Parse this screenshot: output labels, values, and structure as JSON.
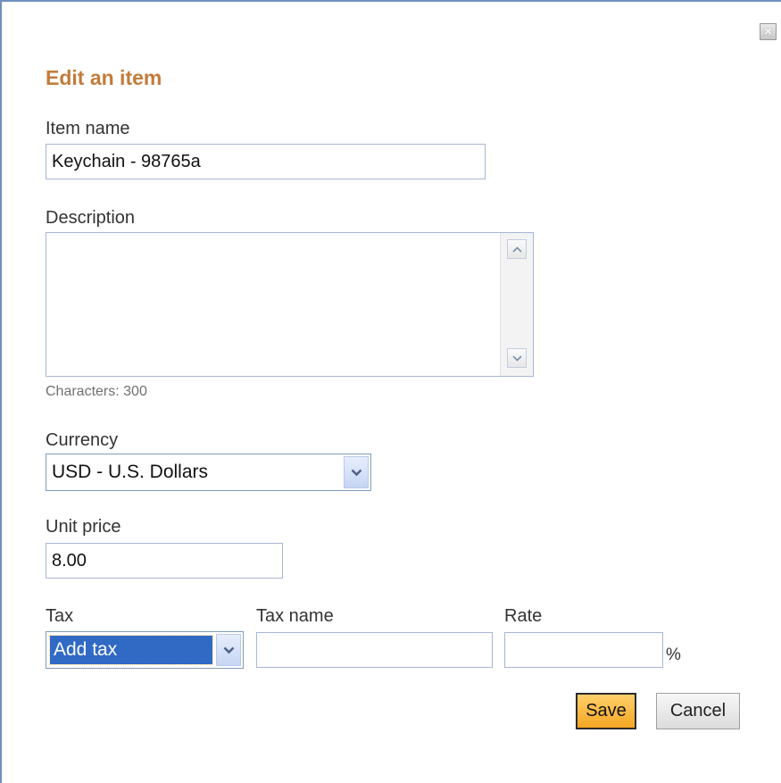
{
  "dialog": {
    "title": "Edit an item",
    "close_icon": "close-icon"
  },
  "item_name": {
    "label": "Item name",
    "value": "Keychain - 98765a"
  },
  "description": {
    "label": "Description",
    "value": "",
    "char_counter": "Characters: 300"
  },
  "currency": {
    "label": "Currency",
    "selected": "USD - U.S. Dollars"
  },
  "unit_price": {
    "label": "Unit price",
    "value": "8.00"
  },
  "tax": {
    "label": "Tax",
    "selected": "Add tax",
    "name_label": "Tax name",
    "name_value": "",
    "rate_label": "Rate",
    "rate_value": "",
    "rate_suffix": "%"
  },
  "actions": {
    "save_label": "Save",
    "cancel_label": "Cancel"
  }
}
